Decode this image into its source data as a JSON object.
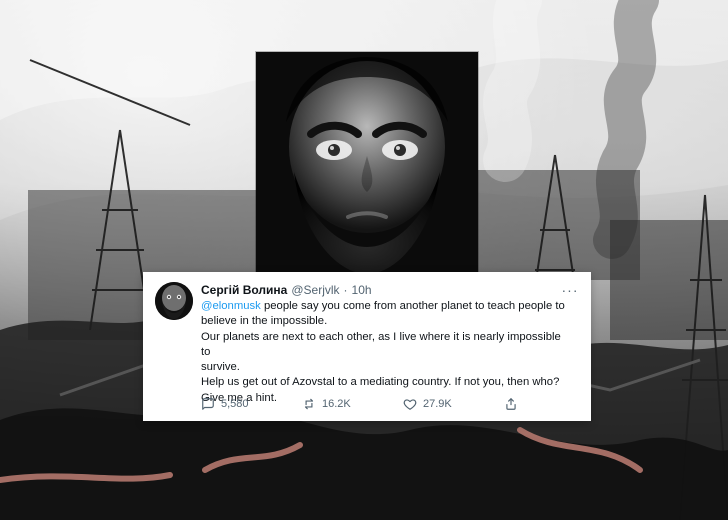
{
  "tweet": {
    "display_name": "Сергій Волина",
    "handle": "@Serjvlk",
    "separator": "·",
    "time": "10h",
    "more_label": "···",
    "mention": "@elonmusk",
    "line1_rest": " people say you come from another planet to teach people to",
    "line2": "believe in the impossible.",
    "line3": "Our planets are next to each other, as I live where it is nearly impossible to",
    "line4": "survive.",
    "line5": "Help us get out of Azovstal to a mediating country. If not you, then who?",
    "line6": "Give me a hint.",
    "actions": {
      "reply_count": "5,580",
      "retweet_count": "16.2K",
      "like_count": "27.9K"
    },
    "icons": {
      "reply": "reply-icon",
      "retweet": "retweet-icon",
      "like": "heart-icon",
      "share": "share-icon",
      "more": "more-icon"
    },
    "colors": {
      "mention": "#1d9bf0",
      "text": "#0f1419",
      "muted": "#536471"
    }
  }
}
